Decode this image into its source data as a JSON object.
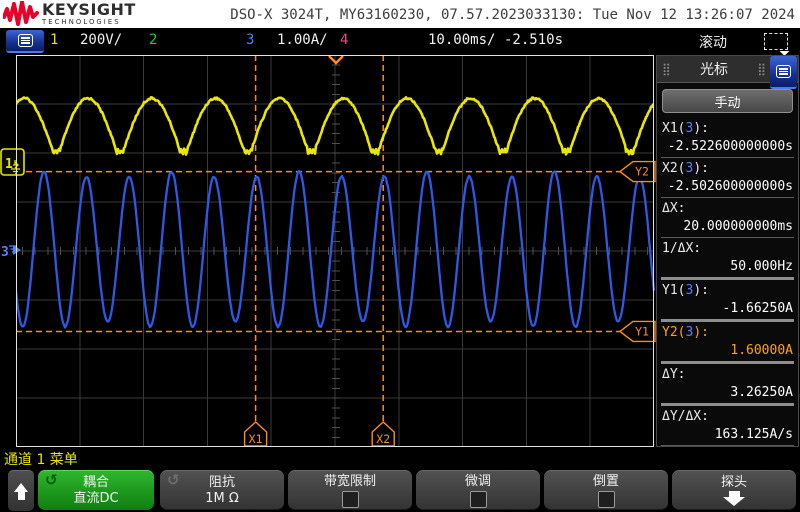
{
  "header": {
    "brand": "KEYSIGHT",
    "brand_sub": "TECHNOLOGIES",
    "title": "DSO-X 3024T, MY63160230, 07.57.2023033130: Tue Nov 12 13:26:07 2024"
  },
  "channel_bar": {
    "channels": [
      {
        "num": "1",
        "scale": "200V/",
        "color": "#e6e600"
      },
      {
        "num": "2",
        "scale": "",
        "color": "#21d021"
      },
      {
        "num": "3",
        "scale": "1.00A/",
        "color": "#5a7cff"
      },
      {
        "num": "4",
        "scale": "",
        "color": "#f0418c"
      }
    ],
    "timebase": "10.00ms/",
    "delay": "-2.510s",
    "mode": "滚动"
  },
  "scope": {
    "trigger_channel_marker": "1",
    "ch3_marker": "3",
    "cursor_tags": {
      "x1": "X1",
      "x2": "X2",
      "y1": "Y1",
      "y2": "Y2"
    }
  },
  "sidebar": {
    "title": "光标",
    "mode_button": "手动",
    "fields": [
      {
        "pre": "X1(",
        "ch": "3",
        "post": "):",
        "value": "-2.522600000000s",
        "sep": "thin"
      },
      {
        "pre": "X2(",
        "ch": "3",
        "post": "):",
        "value": "-2.502600000000s",
        "sep": "thin"
      },
      {
        "pre": "ΔX:",
        "ch": "",
        "post": "",
        "value": "20.000000000ms",
        "sep": "thin"
      },
      {
        "pre": "1/ΔX:",
        "ch": "",
        "post": "",
        "value": "50.000Hz",
        "sep": "thick"
      },
      {
        "pre": "Y1(",
        "ch": "3",
        "post": "):",
        "value": "-1.66250A",
        "sep": "thick"
      },
      {
        "pre": "Y2(",
        "ch": "3",
        "post": "):",
        "value": "1.60000A",
        "sep": "thick",
        "highlight": true
      },
      {
        "pre": "ΔY:",
        "ch": "",
        "post": "",
        "value": "3.26250A",
        "sep": "thick"
      },
      {
        "pre": "ΔY/ΔX:",
        "ch": "",
        "post": "",
        "value": "163.125A/s",
        "sep": "thin"
      }
    ]
  },
  "menu": {
    "label": "通道 1 菜单",
    "buttons": [
      {
        "line1": "耦合",
        "line2": "直流DC"
      },
      {
        "line1": "阻抗",
        "line2": "1M Ω"
      },
      {
        "line1": "带宽限制"
      },
      {
        "line1": "微调"
      },
      {
        "line1": "倒置"
      },
      {
        "line1": "探头"
      }
    ]
  },
  "colors": {
    "accent_orange": "#ff8c1a",
    "ch1_yellow": "#e8e800",
    "ch2_green": "#21d021",
    "ch3_blue": "#2e59e6",
    "ch4_pink": "#f0418c"
  },
  "chart_data": {
    "type": "line",
    "title": "Oscilloscope roll-mode acquisition",
    "x_axis": {
      "time_per_div_ms": 10.0,
      "divisions_h": 10,
      "divisions_v": 8,
      "delay_s": -2.51,
      "mode": "滚动"
    },
    "series": [
      {
        "name": "CH1",
        "shape": "full-wave-rectified-sine",
        "scale": "200V/div",
        "hump_period_ms": 10,
        "peak_v": 260,
        "valley_v": 43,
        "ground_div_from_top": 2.18
      },
      {
        "name": "CH3",
        "shape": "sine",
        "scale": "1.00A/div",
        "period_ms": 6.667,
        "amplitude_a": 1.6,
        "amplitude_ripple_a": 0.14,
        "ground_div_from_top": 3.98
      }
    ],
    "cursors": {
      "x1_s": -2.5226,
      "x2_s": -2.5026,
      "dx_ms": 20.0,
      "inv_dx_hz": 50.0,
      "y1_a": -1.6625,
      "y2_a": 1.6,
      "dy_a": 3.2625,
      "dy_dx": "163.125A/s",
      "source_channel": 3
    }
  }
}
